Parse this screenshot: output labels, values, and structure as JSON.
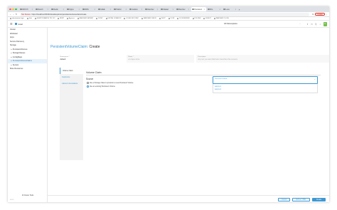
{
  "browser": {
    "tabs": [
      "RDS Hi",
      "Ranch",
      "Redis",
      "Nginx",
      "RDS",
      "Gitlab",
      "Harbor",
      "Jenkins",
      "Rancher",
      "Mariad",
      "Rancher",
      "Persistent",
      "Bro",
      "Lens"
    ],
    "new_tab": "+",
    "security": "Not Secure",
    "url": "https://localhost:8443/c/local/explorer/persistentvolumeclaim/create",
    "update_label": "Update",
    "bookmarks": [
      "administrator login",
      "Jobs",
      "ELASTICSEARCH TILL NO",
      "BURP",
      "Appscan",
      "RANCHER SERVER",
      "CLINIC",
      "DIGITAL OCEAN S3",
      "LOCAL VM CLINIC",
      "RANCHER CHECK",
      "DHCP",
      "CLOB",
      "CLOB SERVER",
      "PLS DNS",
      "FILEDIT",
      "RANCHER CLOUD"
    ],
    "colors": {
      "red": "#ff5f57",
      "yellow": "#febc2e",
      "green": "#28c840"
    }
  },
  "header": {
    "cluster_name": "local",
    "namespace_filter": "All Namespaces",
    "icons": [
      "upload-icon",
      "terminal-icon",
      "kubeconfig-icon",
      "search-icon"
    ],
    "avatar_initial": "R"
  },
  "sidenav": {
    "items": [
      {
        "label": "Cluster",
        "level": 0,
        "active": false
      },
      {
        "label": "Workload",
        "level": 0,
        "active": false
      },
      {
        "label": "Apps",
        "level": 0,
        "active": false
      },
      {
        "label": "Service Discovery",
        "level": 0,
        "active": false
      },
      {
        "label": "Storage",
        "level": 0,
        "active": false
      },
      {
        "label": "PersistentVolumes",
        "level": 1,
        "active": false
      },
      {
        "label": "StorageClasses",
        "level": 1,
        "active": false
      },
      {
        "label": "ConfigMaps",
        "level": 1,
        "active": false
      },
      {
        "label": "PersistentVolumeClaims",
        "level": 1,
        "active": true
      },
      {
        "label": "Secrets",
        "level": 1,
        "active": false
      },
      {
        "label": "More Resources",
        "level": 0,
        "active": false
      }
    ],
    "cluster_tools": "Cluster Tools",
    "version": "v2.6.2"
  },
  "page": {
    "breadcrumb": "PersistentVolumeClaim:",
    "action": " Create",
    "namespace_label": "Namespace *",
    "namespace_value": "default",
    "name_label": "Name *",
    "name_placeholder": "A unique name",
    "description_label": "Description",
    "description_placeholder": "Any text you want that better describes this resource",
    "side_tabs": [
      "Volume Claim",
      "Customize",
      "Labels & Annotations"
    ],
    "section_title": "Volume Claim",
    "source_label": "Source",
    "radio_new": "Use a Storage Class to provision a new Persistent Volume",
    "radio_existing": "Use an existing Persistent Volume",
    "pv_select_label": "Persistent Volume",
    "pv_options": [
      "test-pv-1",
      "test-pv-2"
    ],
    "buttons": {
      "cancel": "Cancel",
      "yaml": "Edit as YAML",
      "create": "Create"
    }
  }
}
